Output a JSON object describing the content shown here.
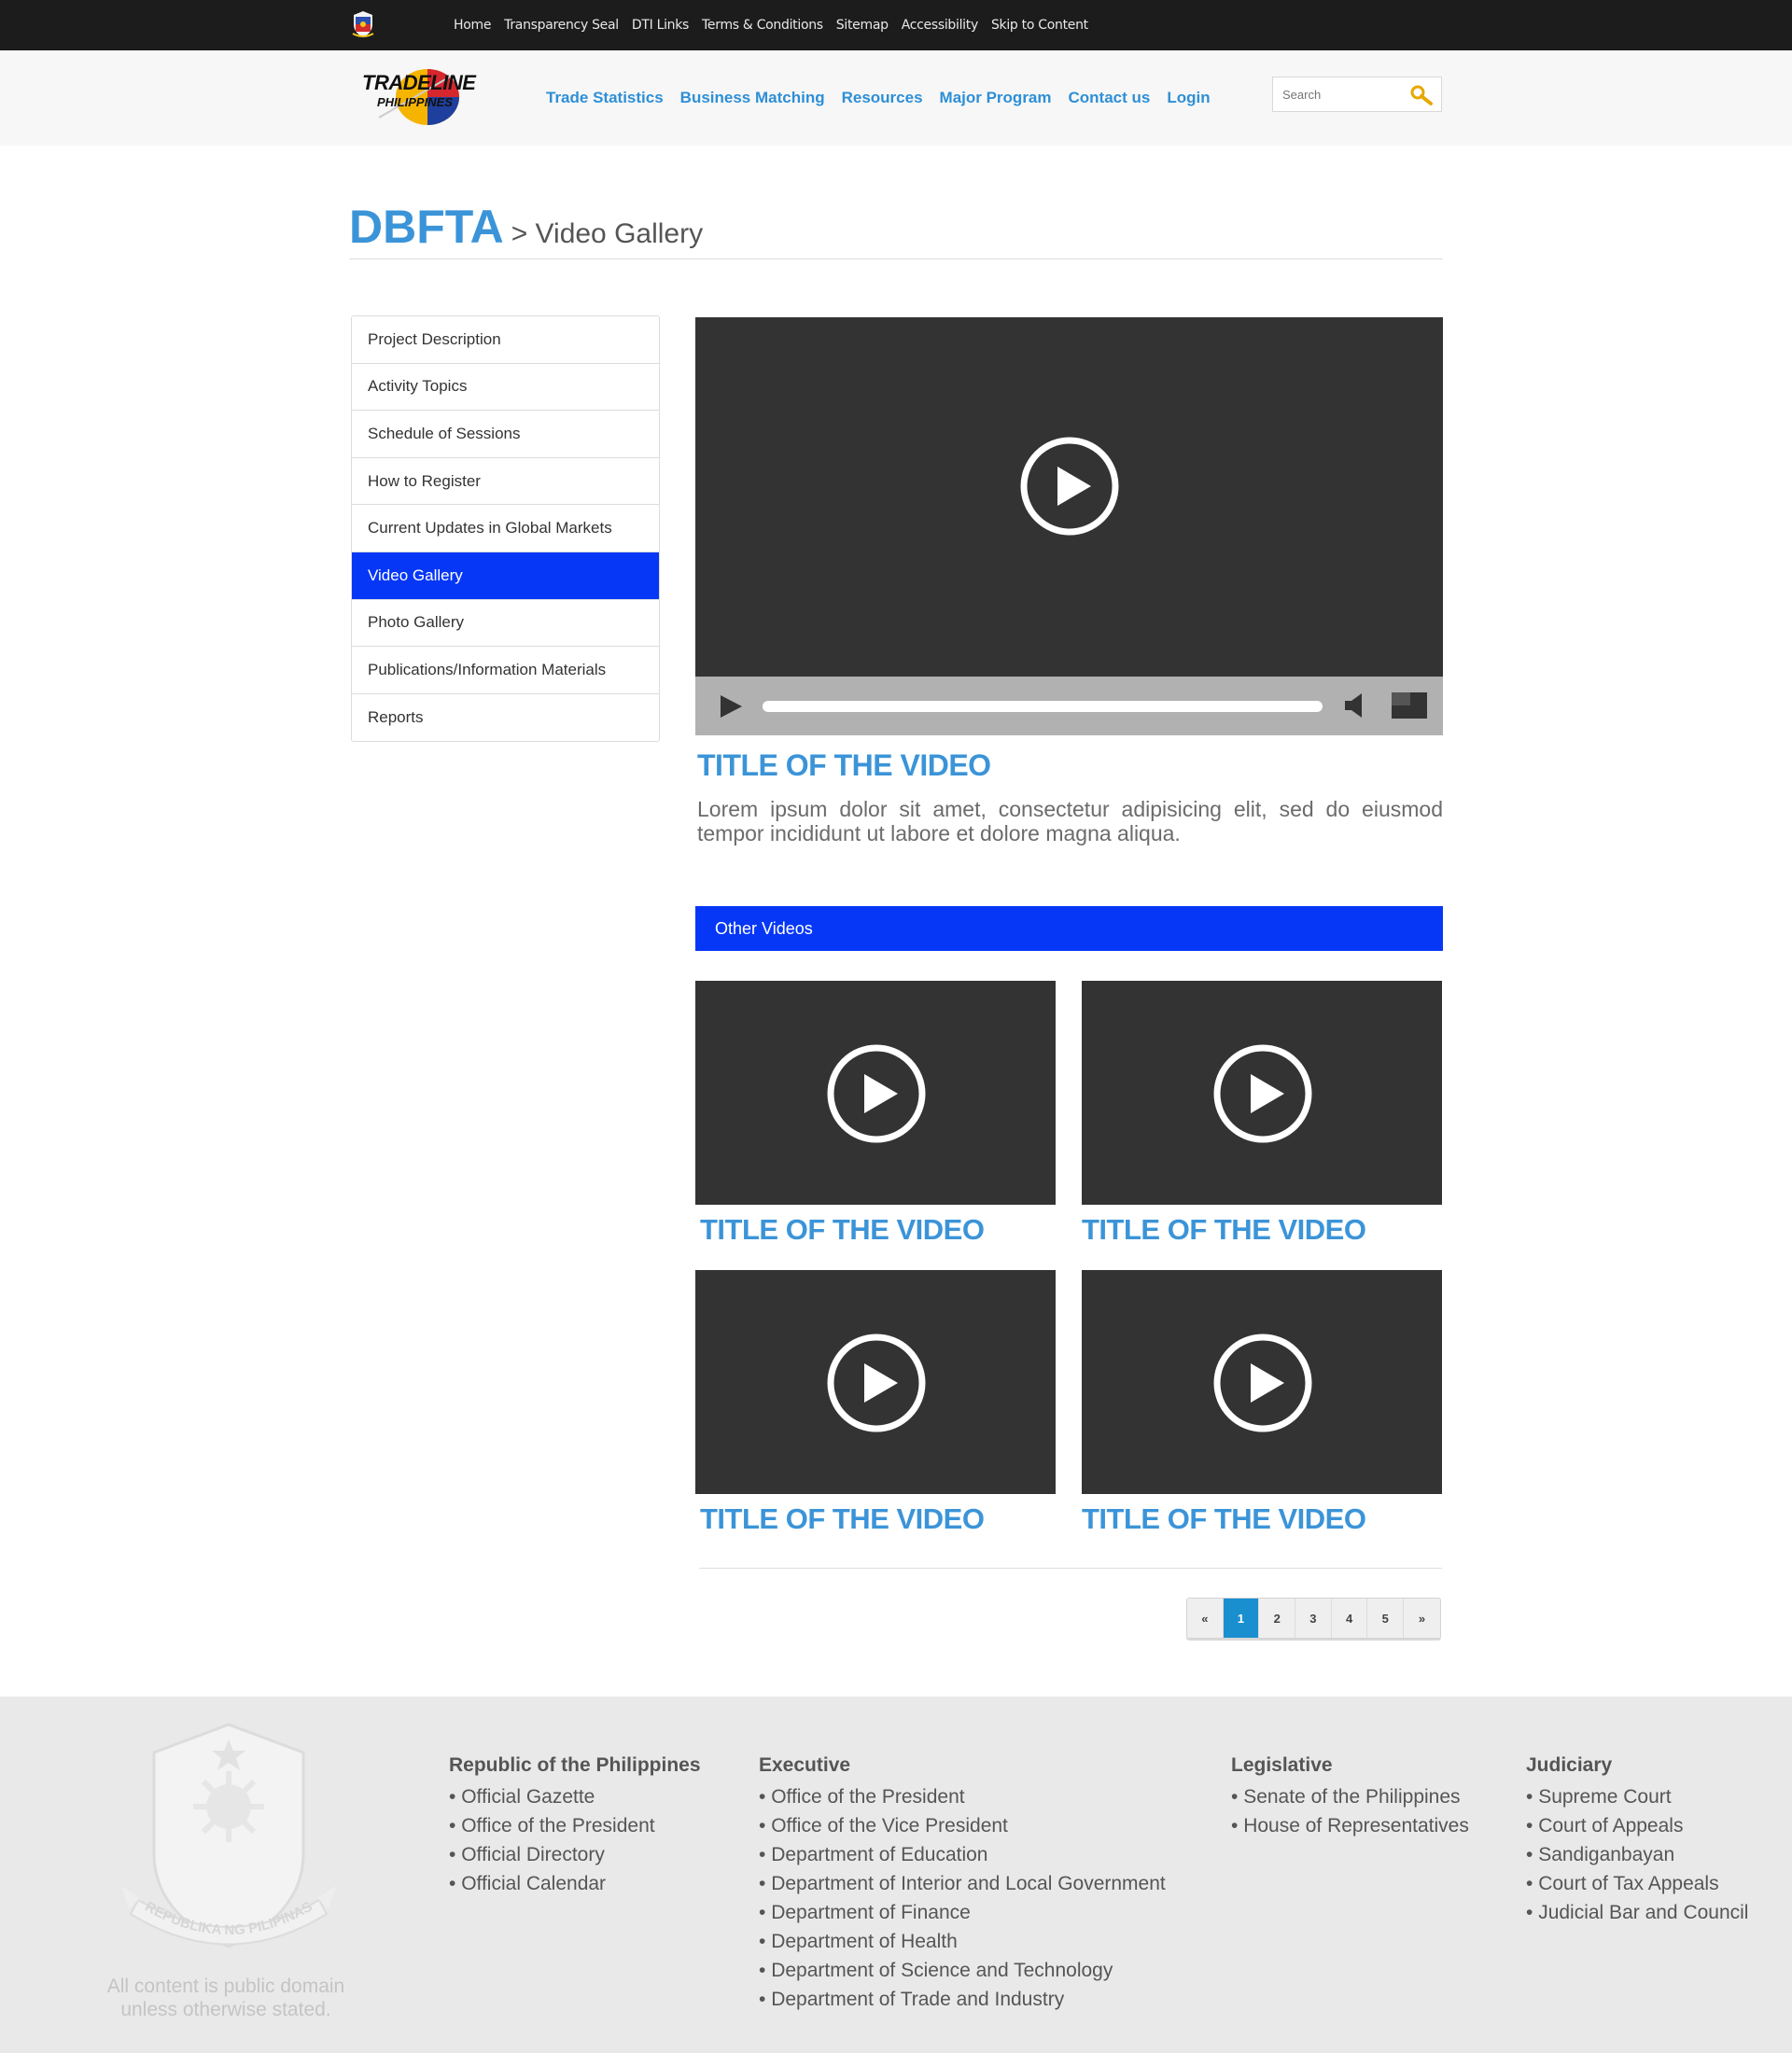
{
  "topbar": {
    "links": [
      "Home",
      "Transparency Seal",
      "DTI Links",
      "Terms & Conditions",
      "Sitemap",
      "Accessibility",
      "Skip to Content"
    ]
  },
  "header": {
    "logo_line1": "TRADELINE",
    "logo_line2": "PHILIPPINES",
    "nav": [
      "Trade Statistics",
      "Business Matching",
      "Resources",
      "Major Program",
      "Contact us",
      "Login"
    ],
    "search_placeholder": "Search"
  },
  "page": {
    "title": "DBFTA",
    "breadcrumb": "> Video Gallery"
  },
  "sidebar": {
    "items": [
      "Project Description",
      "Activity Topics",
      "Schedule of Sessions",
      "How to Register",
      "Current Updates in Global Markets",
      "Video Gallery",
      "Photo Gallery",
      "Publications/Information Materials",
      "Reports"
    ],
    "active_index": 5
  },
  "featured": {
    "title": "TITLE OF THE VIDEO",
    "description": "Lorem ipsum dolor sit amet, consectetur adipisicing elit, sed do eiusmod tempor incididunt ut labore et dolore magna aliqua."
  },
  "other_videos": {
    "heading": "Other Videos",
    "items": [
      {
        "title": "TITLE OF THE VIDEO"
      },
      {
        "title": "TITLE OF THE VIDEO"
      },
      {
        "title": "TITLE OF THE VIDEO"
      },
      {
        "title": "TITLE OF THE VIDEO"
      }
    ]
  },
  "pagination": {
    "prev": "«",
    "pages": [
      "1",
      "2",
      "3",
      "4",
      "5"
    ],
    "next": "»",
    "current": "1"
  },
  "footer": {
    "public_domain": "All content is public domain unless otherwise stated.",
    "seal_text": "REPUBLIKA NG PILIPINAS",
    "columns": [
      {
        "heading": "Republic of the Philippines",
        "links": [
          "Official Gazette",
          "Office of the President",
          "Official Directory",
          "Official Calendar"
        ]
      },
      {
        "heading": "Executive",
        "links": [
          "Office of the President",
          "Office of the Vice President",
          "Department of Education",
          "Department of Interior and Local Government",
          "Department of Finance",
          "Department of Health",
          "Department of Science and Technology",
          "Department of Trade and Industry"
        ]
      },
      {
        "heading": "Legislative",
        "links": [
          "Senate of the Philippines",
          "House of Representatives"
        ]
      },
      {
        "heading": "Judiciary",
        "links": [
          "Supreme Court",
          "Court of Appeals",
          "Sandiganbayan",
          "Court of Tax Appeals",
          "Judicial Bar and Council"
        ]
      }
    ]
  },
  "colors": {
    "accent_blue": "#3b94d8",
    "active_blue": "#0637f7",
    "video_bg": "#333333",
    "pager_active": "#1a8fd0"
  }
}
